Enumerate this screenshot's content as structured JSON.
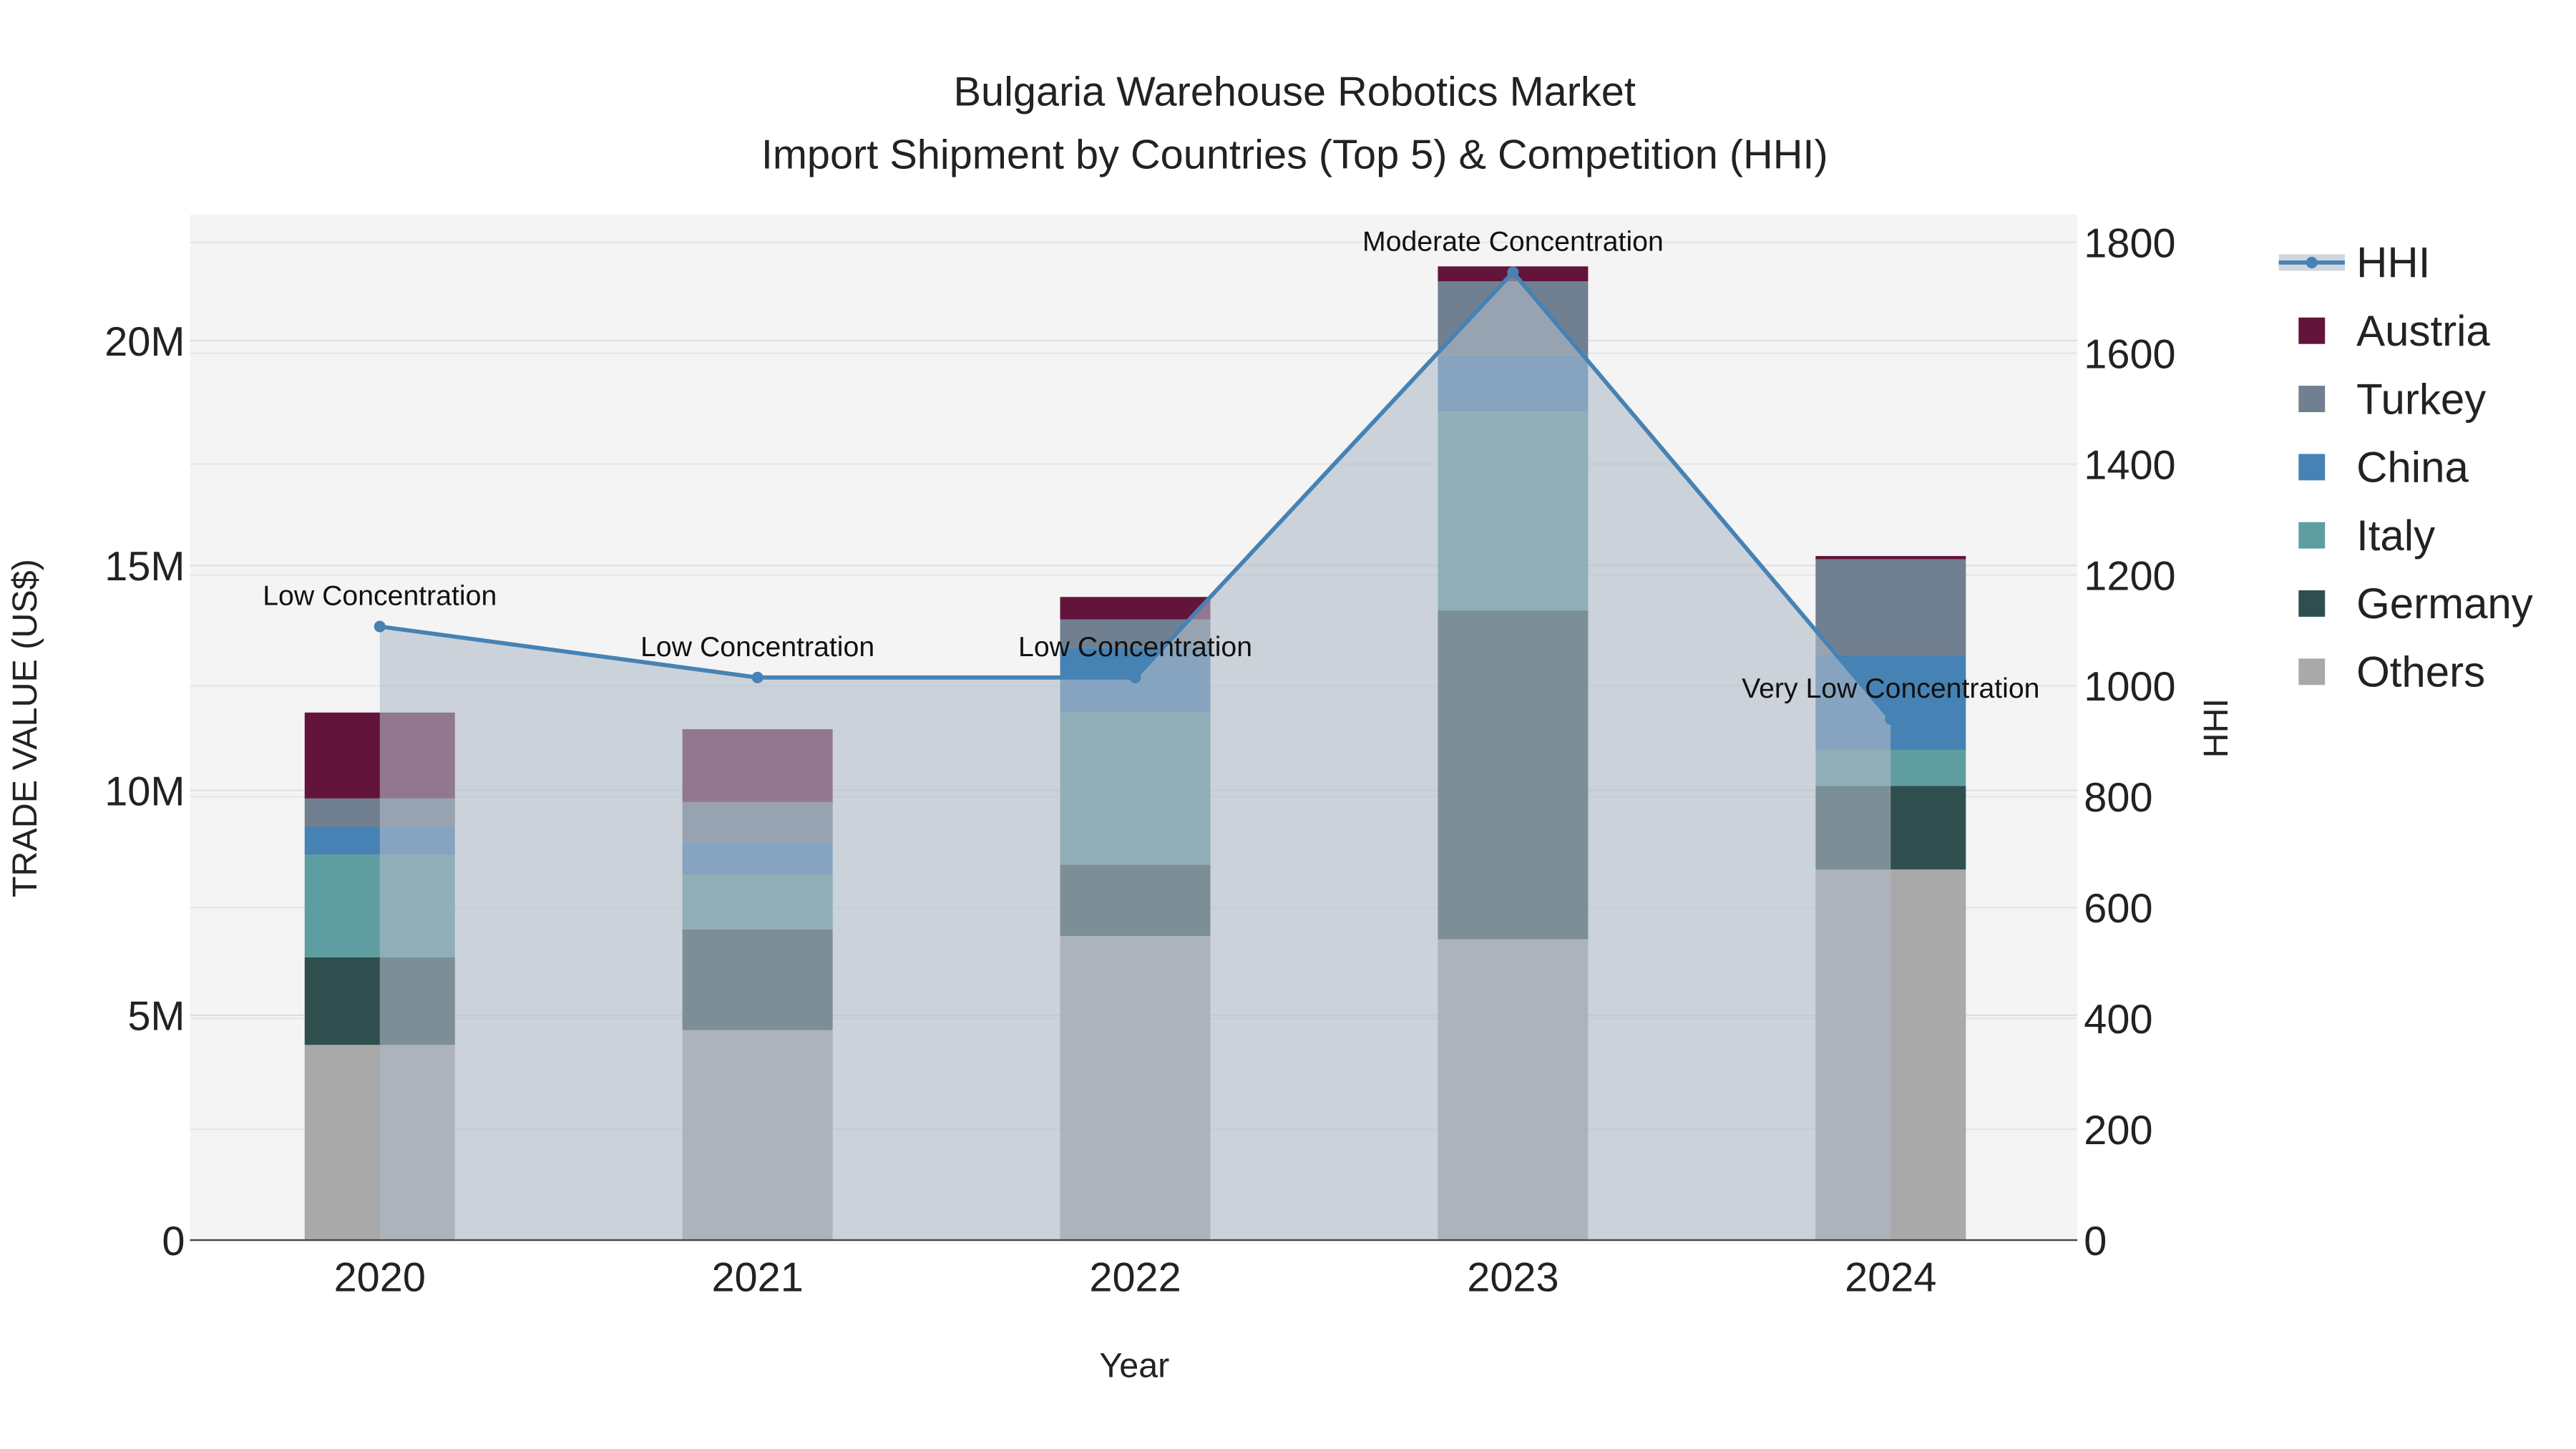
{
  "chart_data": {
    "type": "bar",
    "stacked": true,
    "title": "Bulgaria Warehouse Robotics Market",
    "subtitle": "Import Shipment by Countries (Top 5) & Competition (HHI)",
    "xlabel": "Year",
    "ylabel": "TRADE VALUE (US$)",
    "y2label": "HHI",
    "categories": [
      "2020",
      "2021",
      "2022",
      "2023",
      "2024"
    ],
    "ylim": [
      0,
      22800000
    ],
    "y_ticks": [
      0,
      5000000,
      10000000,
      15000000,
      20000000
    ],
    "y_tick_labels": [
      "0",
      "5M",
      "10M",
      "15M",
      "20M"
    ],
    "y2lim": [
      0,
      1850
    ],
    "y2_ticks": [
      0,
      200,
      400,
      600,
      800,
      1000,
      1200,
      1400,
      1600,
      1800
    ],
    "y2_tick_labels": [
      "0",
      "200",
      "400",
      "600",
      "800",
      "1000",
      "1200",
      "1400",
      "1600",
      "1800"
    ],
    "series": [
      {
        "name": "Others",
        "color": "#A9A9A9",
        "values": [
          4340000,
          4670000,
          6760000,
          6690000,
          8240000
        ]
      },
      {
        "name": "Germany",
        "color": "#2F4F4F",
        "values": [
          1950000,
          2240000,
          1590000,
          7310000,
          1860000
        ]
      },
      {
        "name": "Italy",
        "color": "#5F9EA0",
        "values": [
          2280000,
          1220000,
          3390000,
          4420000,
          800000
        ]
      },
      {
        "name": "China",
        "color": "#4682B4",
        "values": [
          620000,
          730000,
          1430000,
          1250000,
          2100000
        ]
      },
      {
        "name": "Turkey",
        "color": "#708090",
        "values": [
          630000,
          880000,
          630000,
          1650000,
          2140000
        ]
      },
      {
        "name": "Austria",
        "color": "#63143A",
        "values": [
          1910000,
          1620000,
          500000,
          330000,
          70000
        ]
      }
    ],
    "hhi": {
      "name": "HHI",
      "color": "#4682B4",
      "values": [
        1107,
        1015,
        1015,
        1746,
        940
      ],
      "annotations": [
        "Low Concentration",
        "Low Concentration",
        "Low Concentration",
        "Moderate Concentration",
        "Very Low Concentration"
      ]
    },
    "legend": {
      "placement": "right",
      "items": [
        "HHI",
        "Austria",
        "Turkey",
        "China",
        "Italy",
        "Germany",
        "Others"
      ]
    },
    "grid": true
  }
}
